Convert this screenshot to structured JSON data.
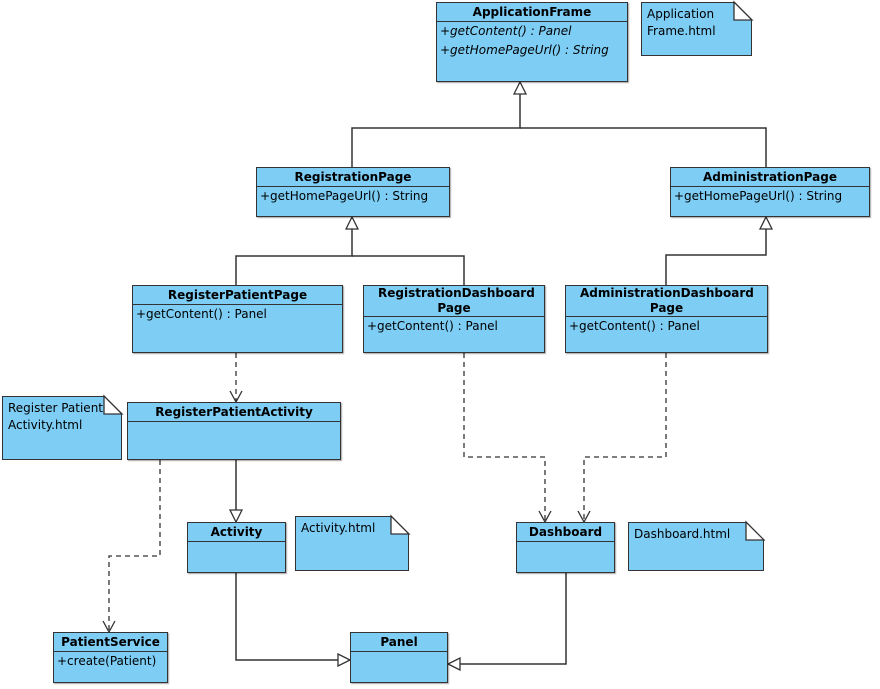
{
  "colors": {
    "class_fill": "#7dcdf5",
    "border": "#333333"
  },
  "classes": {
    "application_frame": {
      "name": "ApplicationFrame",
      "ops": [
        "+getContent() : Panel",
        "+getHomePageUrl() : String"
      ]
    },
    "registration_page": {
      "name": "RegistrationPage",
      "ops": [
        "+getHomePageUrl() : String"
      ]
    },
    "administration_page": {
      "name": "AdministrationPage",
      "ops": [
        "+getHomePageUrl() : String"
      ]
    },
    "register_patient_page": {
      "name": "RegisterPatientPage",
      "ops": [
        "+getContent() : Panel"
      ]
    },
    "registration_dashboard_page": {
      "name": "RegistrationDashboard Page",
      "ops": [
        "+getContent() : Panel"
      ]
    },
    "administration_dashboard_page": {
      "name": "AdministrationDashboard Page",
      "ops": [
        "+getContent() : Panel"
      ]
    },
    "register_patient_activity": {
      "name": "RegisterPatientActivity"
    },
    "activity": {
      "name": "Activity"
    },
    "dashboard": {
      "name": "Dashboard"
    },
    "patient_service": {
      "name": "PatientService",
      "ops": [
        "+create(Patient)"
      ]
    },
    "panel": {
      "name": "Panel"
    }
  },
  "notes": {
    "application_frame": "Application Frame.html",
    "register_patient_activity": "Register Patient Activity.html",
    "activity": "Activity.html",
    "dashboard": "Dashboard.html"
  }
}
